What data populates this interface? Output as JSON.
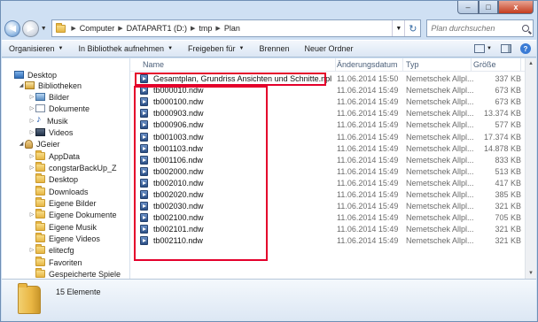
{
  "address": {
    "crumbs": [
      "Computer",
      "DATAPART1 (D:)",
      "tmp",
      "Plan"
    ]
  },
  "search": {
    "placeholder": "Plan durchsuchen"
  },
  "toolbar": {
    "organize": "Organisieren",
    "include_library": "In Bibliothek aufnehmen",
    "share": "Freigeben für",
    "burn": "Brennen",
    "new_folder": "Neuer Ordner"
  },
  "window_controls": {
    "close": "x"
  },
  "columns": {
    "name": "Name",
    "date": "Änderungsdatum",
    "type": "Typ",
    "size": "Größe"
  },
  "nav": [
    {
      "label": "Desktop",
      "icon": "desktop-icon"
    },
    {
      "label": "Bibliotheken",
      "icon": "library-icon"
    },
    {
      "label": "Bilder",
      "icon": "pictures-icon"
    },
    {
      "label": "Dokumente",
      "icon": "documents-icon"
    },
    {
      "label": "Musik",
      "icon": "music-icon"
    },
    {
      "label": "Videos",
      "icon": "videos-icon"
    },
    {
      "label": "JGeier",
      "icon": "user-folder-icon"
    },
    {
      "label": "AppData",
      "icon": "folder-icon"
    },
    {
      "label": "congstarBackUp_Z",
      "icon": "folder-icon"
    },
    {
      "label": "Desktop",
      "icon": "folder-icon"
    },
    {
      "label": "Downloads",
      "icon": "folder-icon"
    },
    {
      "label": "Eigene Bilder",
      "icon": "folder-icon"
    },
    {
      "label": "Eigene Dokumente",
      "icon": "folder-icon"
    },
    {
      "label": "Eigene Musik",
      "icon": "folder-icon"
    },
    {
      "label": "Eigene Videos",
      "icon": "folder-icon"
    },
    {
      "label": "elitecfg",
      "icon": "folder-icon"
    },
    {
      "label": "Favoriten",
      "icon": "folder-icon"
    },
    {
      "label": "Gespeicherte Spiele",
      "icon": "folder-icon"
    }
  ],
  "files": [
    {
      "name": "Gesamtplan, Grundriss Ansichten und Schnitte.npl",
      "date": "11.06.2014 15:50",
      "type": "Nemetschek Allpl...",
      "size": "337 KB"
    },
    {
      "name": "tb000010.ndw",
      "date": "11.06.2014 15:49",
      "type": "Nemetschek Allpl...",
      "size": "673 KB"
    },
    {
      "name": "tb000100.ndw",
      "date": "11.06.2014 15:49",
      "type": "Nemetschek Allpl...",
      "size": "673 KB"
    },
    {
      "name": "tb000903.ndw",
      "date": "11.06.2014 15:49",
      "type": "Nemetschek Allpl...",
      "size": "13.374 KB"
    },
    {
      "name": "tb000906.ndw",
      "date": "11.06.2014 15:49",
      "type": "Nemetschek Allpl...",
      "size": "577 KB"
    },
    {
      "name": "tb001003.ndw",
      "date": "11.06.2014 15:49",
      "type": "Nemetschek Allpl...",
      "size": "17.374 KB"
    },
    {
      "name": "tb001103.ndw",
      "date": "11.06.2014 15:49",
      "type": "Nemetschek Allpl...",
      "size": "14.878 KB"
    },
    {
      "name": "tb001106.ndw",
      "date": "11.06.2014 15:49",
      "type": "Nemetschek Allpl...",
      "size": "833 KB"
    },
    {
      "name": "tb002000.ndw",
      "date": "11.06.2014 15:49",
      "type": "Nemetschek Allpl...",
      "size": "513 KB"
    },
    {
      "name": "tb002010.ndw",
      "date": "11.06.2014 15:49",
      "type": "Nemetschek Allpl...",
      "size": "417 KB"
    },
    {
      "name": "tb002020.ndw",
      "date": "11.06.2014 15:49",
      "type": "Nemetschek Allpl...",
      "size": "385 KB"
    },
    {
      "name": "tb002030.ndw",
      "date": "11.06.2014 15:49",
      "type": "Nemetschek Allpl...",
      "size": "321 KB"
    },
    {
      "name": "tb002100.ndw",
      "date": "11.06.2014 15:49",
      "type": "Nemetschek Allpl...",
      "size": "705 KB"
    },
    {
      "name": "tb002101.ndw",
      "date": "11.06.2014 15:49",
      "type": "Nemetschek Allpl...",
      "size": "321 KB"
    },
    {
      "name": "tb002110.ndw",
      "date": "11.06.2014 15:49",
      "type": "Nemetschek Allpl...",
      "size": "321 KB"
    }
  ],
  "status": {
    "count": "15 Elemente"
  },
  "annotation_color": "#e4002b"
}
